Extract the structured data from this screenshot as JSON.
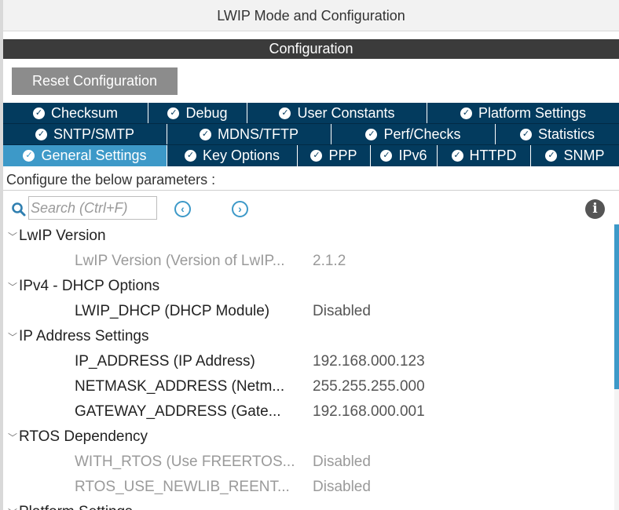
{
  "window": {
    "title": "LWIP Mode and Configuration"
  },
  "section": {
    "title": "Configuration"
  },
  "toolbar": {
    "reset_label": "Reset Configuration"
  },
  "tabs": {
    "row1": [
      {
        "label": "Checksum",
        "active": false
      },
      {
        "label": "Debug",
        "active": false
      },
      {
        "label": "User Constants",
        "active": false
      },
      {
        "label": "Platform Settings",
        "active": false
      }
    ],
    "row2": [
      {
        "label": "SNTP/SMTP",
        "active": false
      },
      {
        "label": "MDNS/TFTP",
        "active": false
      },
      {
        "label": "Perf/Checks",
        "active": false
      },
      {
        "label": "Statistics",
        "active": false
      }
    ],
    "row3": [
      {
        "label": "General Settings",
        "active": true
      },
      {
        "label": "Key Options",
        "active": false
      },
      {
        "label": "PPP",
        "active": false
      },
      {
        "label": "IPv6",
        "active": false
      },
      {
        "label": "HTTPD",
        "active": false
      },
      {
        "label": "SNMP",
        "active": false
      }
    ]
  },
  "params_label": "Configure the below parameters :",
  "search": {
    "placeholder": "Search (Ctrl+F)"
  },
  "icons": {
    "check": "check-circle-icon",
    "search": "search-icon",
    "prev": "chevron-left-icon",
    "next": "chevron-right-icon",
    "info": "info-icon",
    "expand": "chevron-down-icon"
  },
  "colors": {
    "tab_bg": "#033b5e",
    "tab_active": "#3d99c8",
    "header_bg": "#3b3b3b",
    "reset_bg": "#8c8c8c"
  },
  "tree": {
    "groups": [
      {
        "label": "LwIP Version",
        "params": [
          {
            "name": "LwIP Version (Version of LwIP...",
            "value": "2.1.2",
            "dim": true
          }
        ]
      },
      {
        "label": "IPv4 - DHCP Options",
        "params": [
          {
            "name": "LWIP_DHCP (DHCP Module)",
            "value": "Disabled",
            "dim": false
          }
        ]
      },
      {
        "label": "IP Address Settings",
        "params": [
          {
            "name": "IP_ADDRESS (IP Address)",
            "value": "192.168.000.123",
            "dim": false
          },
          {
            "name": "NETMASK_ADDRESS (Netm...",
            "value": "255.255.255.000",
            "dim": false
          },
          {
            "name": "GATEWAY_ADDRESS (Gate...",
            "value": "192.168.000.001",
            "dim": false
          }
        ]
      },
      {
        "label": "RTOS Dependency",
        "params": [
          {
            "name": "WITH_RTOS (Use FREERTOS...",
            "value": "Disabled",
            "dim": true
          },
          {
            "name": "RTOS_USE_NEWLIB_REENT...",
            "value": "Disabled",
            "dim": true
          }
        ]
      },
      {
        "label": "Platform Settings",
        "params": []
      }
    ]
  }
}
